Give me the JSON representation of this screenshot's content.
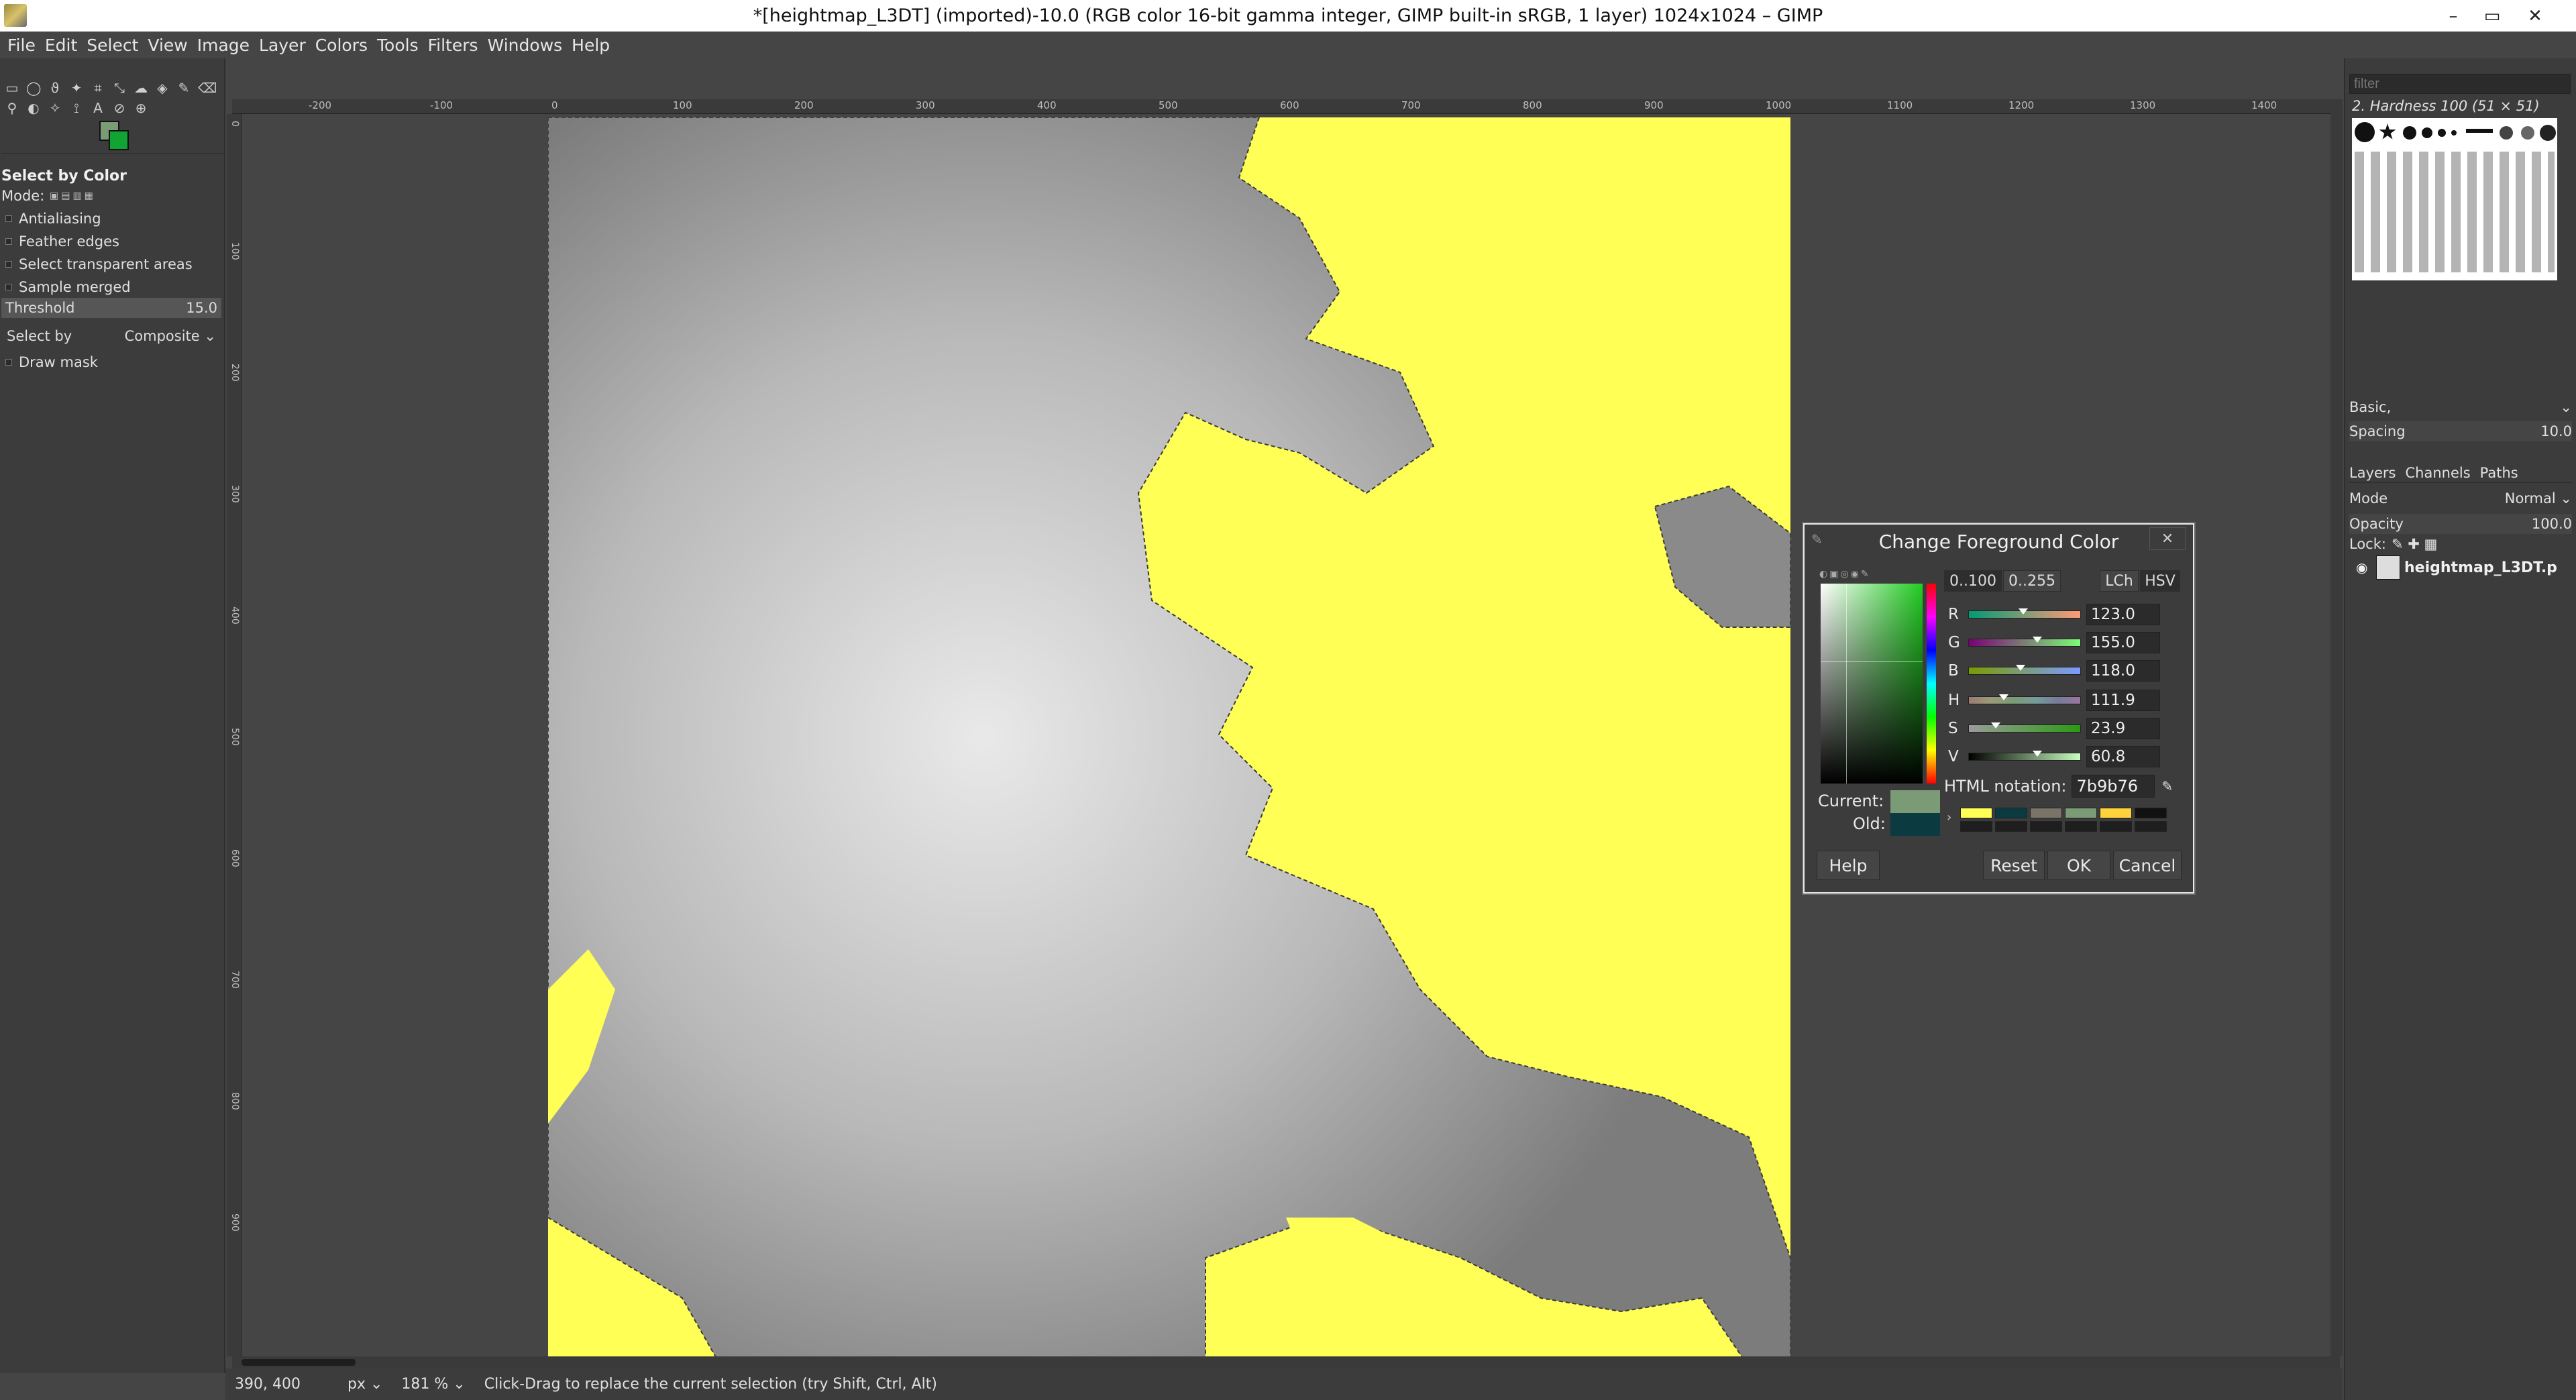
{
  "window": {
    "title": "*[heightmap_L3DT] (imported)-10.0 (RGB color 16-bit gamma integer, GIMP built-in sRGB, 1 layer) 1024x1024 – GIMP",
    "controls": [
      "–",
      "▭",
      "✕"
    ]
  },
  "menu": [
    "File",
    "Edit",
    "Select",
    "View",
    "Image",
    "Layer",
    "Colors",
    "Tools",
    "Filters",
    "Windows",
    "Help"
  ],
  "toolbox": {
    "tool_title": "Select by Color",
    "mode_label": "Mode:",
    "options": [
      {
        "label": "Antialiasing"
      },
      {
        "label": "Feather edges"
      },
      {
        "label": "Select transparent areas"
      },
      {
        "label": "Sample merged"
      }
    ],
    "threshold_label": "Threshold",
    "threshold_value": "15.0",
    "selectby_label": "Select by",
    "selectby_value": "Composite",
    "draw_mask_label": "Draw mask",
    "fg_color": "#7b9b76",
    "bg_color": "#11a433"
  },
  "ruler_top": [
    "-200",
    "-100",
    "0",
    "100",
    "200",
    "300",
    "400",
    "500",
    "600",
    "700",
    "800",
    "900",
    "1000",
    "1100",
    "1200",
    "1300",
    "1400"
  ],
  "ruler_left": [
    "0",
    "100",
    "200",
    "300",
    "400",
    "500",
    "600",
    "700",
    "800",
    "900"
  ],
  "statusbar": {
    "coords": "390, 400",
    "unit": "px",
    "zoom": "181 %",
    "message": "Click-Drag to replace the current selection (try Shift, Ctrl, Alt)"
  },
  "dock": {
    "filter_placeholder": "filter",
    "brush_title": "2. Hardness 100 (51 × 51)",
    "brush_preset": "Basic,",
    "spacing_label": "Spacing",
    "spacing_value": "10.0",
    "tabs": [
      "Layers",
      "Channels",
      "Paths"
    ],
    "mode_label": "Mode",
    "mode_value": "Normal",
    "opacity_label": "Opacity",
    "opacity_value": "100.0",
    "lock_label": "Lock:",
    "layer_name": "heightmap_L3DT.p"
  },
  "dialog": {
    "title": "Change Foreground Color",
    "range_a": "0..100",
    "range_b": "0..255",
    "mode_a": "LCh",
    "mode_b": "HSV",
    "channels": [
      {
        "label": "R",
        "value": "123.0",
        "fraction": 0.48
      },
      {
        "label": "G",
        "value": "155.0",
        "fraction": 0.61
      },
      {
        "label": "B",
        "value": "118.0",
        "fraction": 0.46
      },
      {
        "label": "H",
        "value": "111.9",
        "fraction": 0.31
      },
      {
        "label": "S",
        "value": "23.9",
        "fraction": 0.24
      },
      {
        "label": "V",
        "value": "60.8",
        "fraction": 0.61
      }
    ],
    "html_label": "HTML notation:",
    "html_value": "7b9b76",
    "current_label": "Current:",
    "old_label": "Old:",
    "current_color": "#7b9b76",
    "old_color": "#0b3b40",
    "history_colors": [
      "#ffff55",
      "#0b3b40",
      "#7a7468",
      "#7b9b76",
      "#ffd23c",
      "#111111"
    ],
    "buttons": {
      "help": "Help",
      "reset": "Reset",
      "ok": "OK",
      "cancel": "Cancel"
    }
  }
}
